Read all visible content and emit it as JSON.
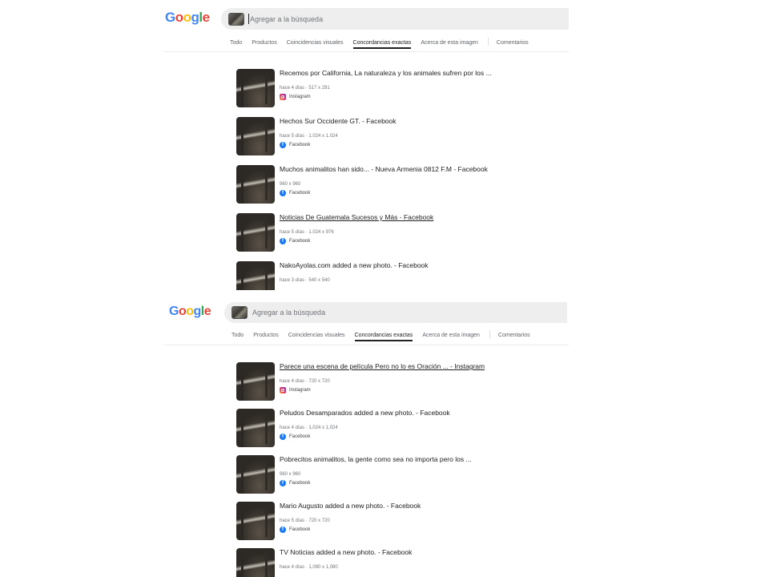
{
  "search": {
    "placeholder": "Agregar a la búsqueda"
  },
  "logo": {
    "letters": [
      "G",
      "o",
      "o",
      "g",
      "l",
      "e"
    ]
  },
  "tabs": [
    "Todo",
    "Productos",
    "Coincidencias visuales",
    "Concordancias exactas",
    "Acerca de esta imagen",
    "Comentarios"
  ],
  "active_tab": "Concordancias exactas",
  "icons": {
    "instagram": "instagram-icon",
    "facebook": "facebook-icon"
  },
  "colors": {
    "google_blue": "#4285f4",
    "google_red": "#ea4335",
    "google_yellow": "#fbbc05",
    "google_green": "#34a853",
    "facebook": "#1877f2"
  },
  "panel_top": {
    "results": [
      {
        "title": "Recemos por California, La naturaleza y los animales sufren por los ...",
        "meta": "hace 4 días · 517 x 291",
        "source": "Instagram",
        "icon": "instagram"
      },
      {
        "title": "Hechos Sur Occidente GT. - Facebook",
        "meta": "hace 5 días · 1.024 x 1.024",
        "source": "Facebook",
        "icon": "facebook"
      },
      {
        "title": "Muchos animalitos han sido... - Nueva Armenia 0812 F.M - Facebook",
        "meta": "960 x 960",
        "source": "Facebook",
        "icon": "facebook"
      },
      {
        "title": "Noticias De Guatemala Sucesos y Más - Facebook",
        "meta": "hace 5 días · 1.024 x 976",
        "source": "Facebook",
        "icon": "facebook"
      },
      {
        "title": "NakoAyolas.com added a new photo. - Facebook",
        "meta": "hace 3 días · 540 x 540",
        "source": "",
        "icon": ""
      }
    ]
  },
  "panel_bottom": {
    "results": [
      {
        "title": "Parece una escena de película Pero no lo es Oración ... - Instagram",
        "meta": "hace 4 días · 720 x 720",
        "source": "Instagram",
        "icon": "instagram"
      },
      {
        "title": "Peludos Desamparados added a new photo. - Facebook",
        "meta": "hace 4 días · 1,024 x 1,024",
        "source": "Facebook",
        "icon": "facebook"
      },
      {
        "title": "Pobrecitos animalitos, la gente como sea no importa pero los ...",
        "meta": "960 x 960",
        "source": "Facebook",
        "icon": "facebook"
      },
      {
        "title": "Mario Augusto added a new photo. - Facebook",
        "meta": "hace 5 días · 720 x 720",
        "source": "Facebook",
        "icon": "facebook"
      },
      {
        "title": "TV Noticias added a new photo. - Facebook",
        "meta": "hace 4 días · 1,080 x 1,080",
        "source": "",
        "icon": ""
      }
    ]
  }
}
